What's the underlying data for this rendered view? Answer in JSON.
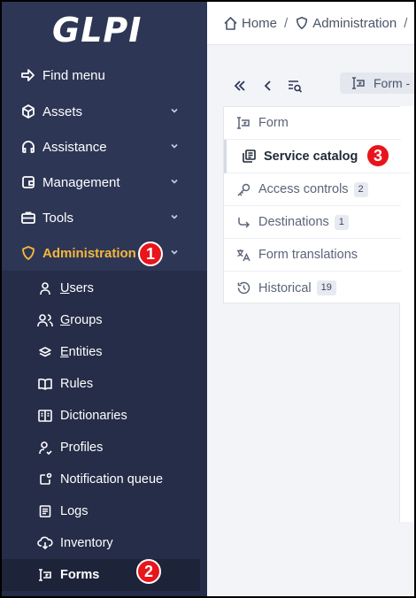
{
  "logo": {
    "text": "GLPI"
  },
  "sidebar": {
    "items": [
      {
        "label": "Find menu",
        "icon": "arrow-right-icon"
      },
      {
        "label": "Assets",
        "icon": "cube-icon"
      },
      {
        "label": "Assistance",
        "icon": "headset-icon"
      },
      {
        "label": "Management",
        "icon": "wallet-icon"
      },
      {
        "label": "Tools",
        "icon": "briefcase-icon"
      },
      {
        "label": "Administration",
        "icon": "shield-icon",
        "active": true
      }
    ],
    "submenu": [
      {
        "label": "Users",
        "icon": "user-icon"
      },
      {
        "label": "Groups",
        "icon": "users-icon"
      },
      {
        "label": "Entities",
        "icon": "stack-icon"
      },
      {
        "label": "Rules",
        "icon": "book-icon"
      },
      {
        "label": "Dictionaries",
        "icon": "dictionary-icon"
      },
      {
        "label": "Profiles",
        "icon": "user-check-icon"
      },
      {
        "label": "Notification queue",
        "icon": "notification-icon"
      },
      {
        "label": "Logs",
        "icon": "log-icon"
      },
      {
        "label": "Inventory",
        "icon": "cloud-download-icon"
      },
      {
        "label": "Forms",
        "icon": "forms-icon",
        "active": true
      }
    ],
    "active_color": "#f4b73c"
  },
  "topbar": {
    "breadcrumb": [
      "Home",
      "Administration"
    ],
    "separator": "/"
  },
  "toolbar": {
    "form_chip_label": "Form -"
  },
  "tabs": [
    {
      "label": "Form",
      "icon": "form-icon"
    },
    {
      "label": "Service catalog",
      "icon": "catalog-icon",
      "active": true
    },
    {
      "label": "Access controls",
      "icon": "key-icon",
      "count": "2"
    },
    {
      "label": "Destinations",
      "icon": "redirect-icon",
      "count": "1"
    },
    {
      "label": "Form translations",
      "icon": "translate-icon"
    },
    {
      "label": "Historical",
      "icon": "history-icon",
      "count": "19"
    }
  ],
  "markers": [
    "1",
    "2",
    "3"
  ],
  "colors": {
    "sidebar_bg": "#2d3655",
    "submenu_bg": "#252d48",
    "marker_red": "#e8151b"
  }
}
